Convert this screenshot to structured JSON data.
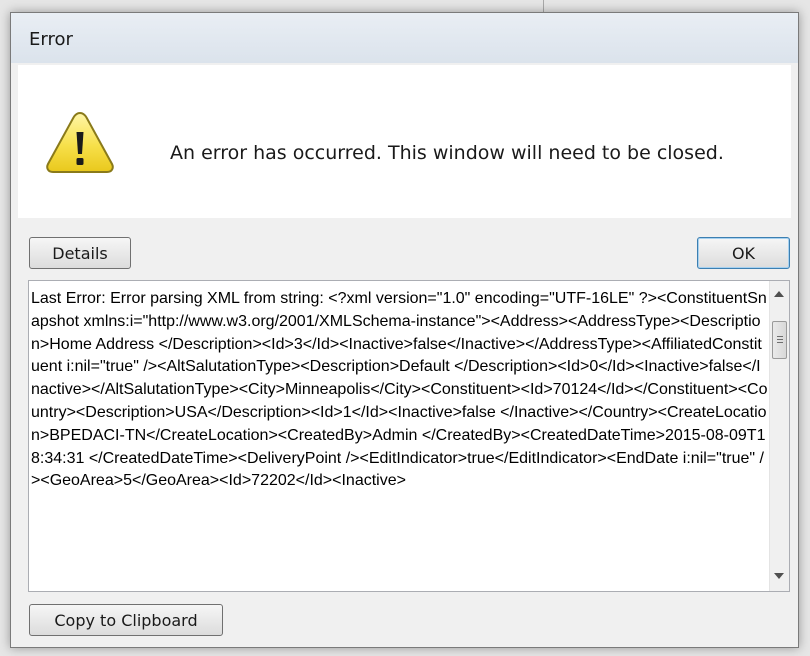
{
  "dialog": {
    "title": "Error",
    "message": "An error has occurred. This window will need to be closed.",
    "icon": "warning-icon",
    "details_button": "Details",
    "ok_button": "OK",
    "details_text": "Last Error: Error parsing XML from string: <?xml version=\"1.0\" encoding=\"UTF-16LE\" ?><ConstituentSnapshot xmlns:i=\"http://www.w3.org/2001/XMLSchema-instance\"><Address><AddressType><Description>Home Address </Description><Id>3</Id><Inactive>false</Inactive></AddressType><AffiliatedConstituent i:nil=\"true\" /><AltSalutationType><Description>Default </Description><Id>0</Id><Inactive>false</Inactive></AltSalutationType><City>Minneapolis</City><Constituent><Id>70124</Id></Constituent><Country><Description>USA</Description><Id>1</Id><Inactive>false </Inactive></Country><CreateLocation>BPEDACI-TN</CreateLocation><CreatedBy>Admin </CreatedBy><CreatedDateTime>2015-08-09T18:34:31 </CreatedDateTime><DeliveryPoint /><EditIndicator>true</EditIndicator><EndDate i:nil=\"true\" /><GeoArea>5</GeoArea><Id>72202</Id><Inactive>",
    "copy_button": "Copy to Clipboard"
  },
  "colors": {
    "warning_fill": "#f7e04a",
    "warning_stroke": "#8a7a1a",
    "ok_border": "#3c7fb1"
  }
}
